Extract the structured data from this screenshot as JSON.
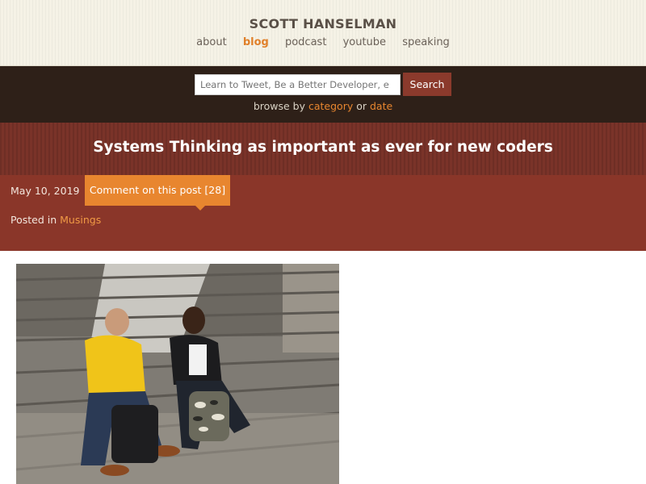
{
  "header": {
    "site_title": "SCOTT HANSELMAN",
    "nav": [
      {
        "label": "about",
        "active": false
      },
      {
        "label": "blog",
        "active": true
      },
      {
        "label": "podcast",
        "active": false
      },
      {
        "label": "youtube",
        "active": false
      },
      {
        "label": "speaking",
        "active": false
      }
    ]
  },
  "search": {
    "placeholder": "Learn to Tweet, Be a Better Developer, e",
    "button_label": "Search",
    "browse_prefix": "browse by",
    "browse_category": "category",
    "browse_or": "or",
    "browse_date": "date"
  },
  "post": {
    "title": "Systems Thinking as important as ever for new coders",
    "date": "May 10, 2019",
    "comment_label": "Comment on this post [28]",
    "posted_in_prefix": "Posted in",
    "category": "Musings"
  },
  "colors": {
    "accent_orange": "#e8862f",
    "dark_band": "#2e2018",
    "title_band": "#7a3329",
    "meta_band": "#8a3629"
  }
}
